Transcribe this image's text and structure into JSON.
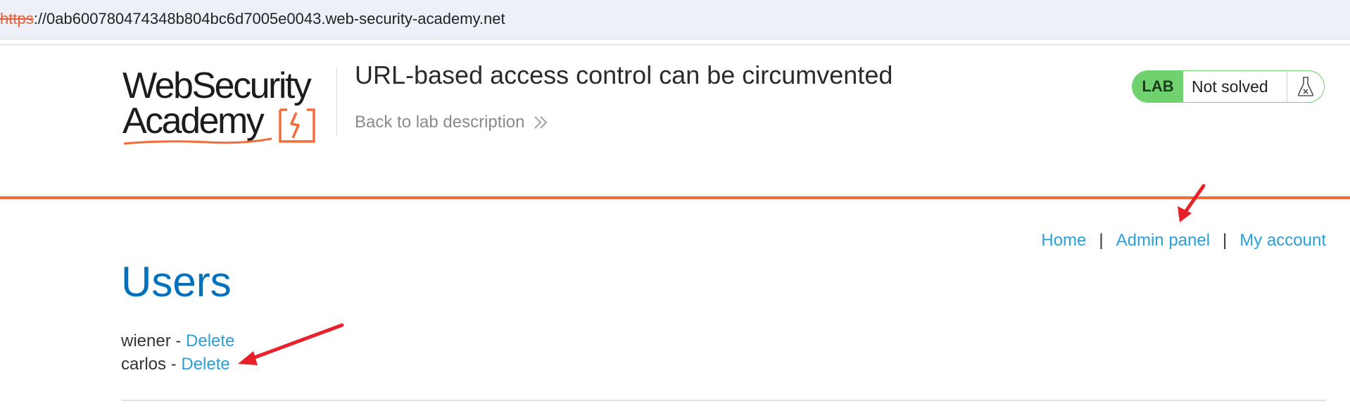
{
  "browser": {
    "url_scheme": "https",
    "url_rest": "://0ab600780474348b804bc6d7005e0043.web-security-academy.net"
  },
  "header": {
    "logo_line1": "WebSecurity",
    "logo_line2": "Academy",
    "lab_title": "URL-based access control can be circumvented",
    "back_link": "Back to lab description",
    "badge_label": "LAB",
    "badge_status": "Not solved",
    "badge_icon": "flask-icon"
  },
  "nav": {
    "items": [
      "Home",
      "Admin panel",
      "My account"
    ],
    "separator": "|"
  },
  "main": {
    "title": "Users",
    "users": [
      {
        "name": "wiener",
        "dash": " - ",
        "action": "Delete"
      },
      {
        "name": "carlos",
        "dash": " - ",
        "action": "Delete"
      }
    ]
  },
  "colors": {
    "accent_orange": "#f26b38",
    "link_blue": "#2b9fd9",
    "heading_blue": "#0071bc",
    "lab_green": "#70d16f",
    "annotation_red": "#e8202a"
  }
}
